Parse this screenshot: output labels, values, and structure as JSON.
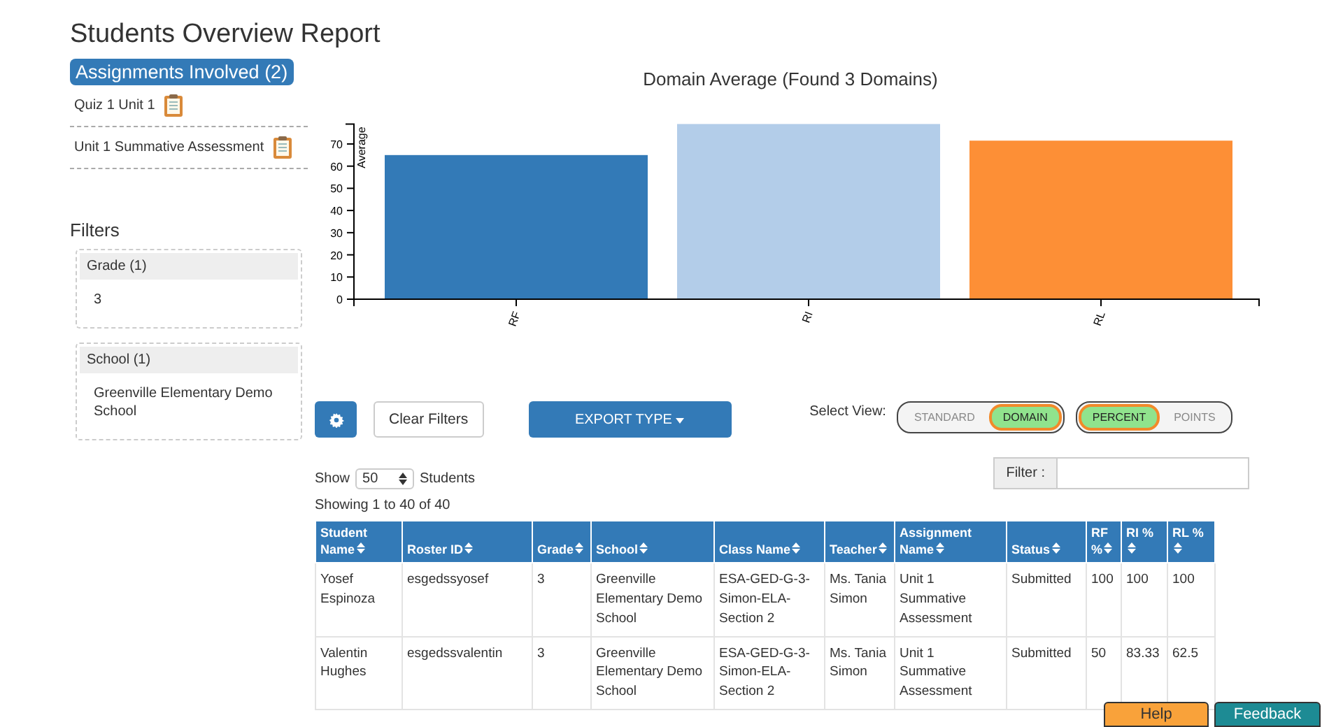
{
  "page_title": "Students Overview Report",
  "assignments": {
    "heading": "Assignments Involved (2)",
    "items": [
      "Quiz 1 Unit 1",
      "Unit 1 Summative Assessment"
    ]
  },
  "filters": {
    "heading": "Filters",
    "groups": [
      {
        "title": "Grade (1)",
        "values": [
          "3"
        ]
      },
      {
        "title": "School (1)",
        "values": [
          "Greenville Elementary Demo School"
        ]
      }
    ]
  },
  "chart_data": {
    "type": "bar",
    "title": "Domain Average (Found 3 Domains)",
    "ylabel": "Average",
    "series": [
      {
        "name": "RF",
        "color": "#337ab7",
        "values": [
          65,
          null,
          null
        ]
      },
      {
        "name": "RI",
        "color": "#b3cde9",
        "values": [
          null,
          79,
          null
        ]
      },
      {
        "name": "RL",
        "color": "#fd8f36",
        "values": [
          null,
          null,
          71.5
        ]
      }
    ],
    "stacked": true,
    "ylim": [
      0,
      79
    ],
    "yticks": [
      0,
      10,
      20,
      30,
      40,
      50,
      60,
      70
    ]
  },
  "toolbar": {
    "clear_label": "Clear Filters",
    "export_label": "EXPORT TYPE",
    "view_label": "Select View:",
    "toggles": [
      [
        {
          "label": "STANDARD",
          "selected": false
        },
        {
          "label": "DOMAIN",
          "selected": true
        }
      ],
      [
        {
          "label": "PERCENT",
          "selected": true
        },
        {
          "label": "POINTS",
          "selected": false
        }
      ]
    ]
  },
  "length": {
    "before": "Show",
    "value": "50",
    "after": "Students"
  },
  "filter": {
    "label": "Filter :"
  },
  "info": "Showing 1 to 40 of 40",
  "table": {
    "columns": [
      "Student Name",
      "Roster ID",
      "Grade",
      "School",
      "Class Name",
      "Teacher",
      "Assignment Name",
      "Status",
      "RF %",
      "RI %",
      "RL %"
    ],
    "rows": [
      [
        "Yosef Espinoza",
        "esgedssyosef",
        "3",
        "Greenville Elementary Demo School",
        "ESA-GED-G-3-Simon-ELA-Section 2",
        "Ms. Tania Simon",
        "Unit 1 Summative Assessment",
        "Submitted",
        "100",
        "100",
        "100"
      ],
      [
        "Valentin Hughes",
        "esgedssvalentin",
        "3",
        "Greenville Elementary Demo School",
        "ESA-GED-G-3-Simon-ELA-Section 2",
        "Ms. Tania Simon",
        "Unit 1 Summative Assessment",
        "Submitted",
        "50",
        "83.33",
        "62.5"
      ]
    ]
  },
  "footer_buttons": [
    "Help",
    "Feedback"
  ]
}
